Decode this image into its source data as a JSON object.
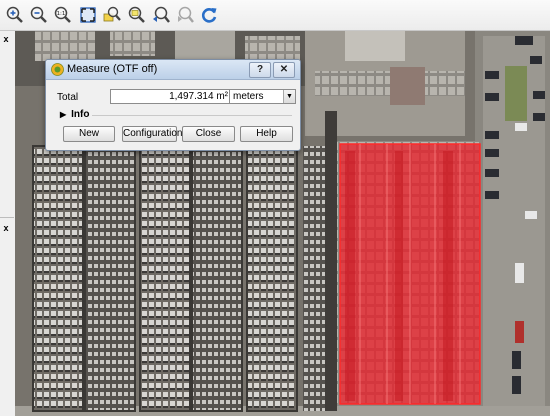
{
  "toolbar": {
    "tools": [
      {
        "icon": "zoom-in-icon"
      },
      {
        "icon": "zoom-out-icon"
      },
      {
        "icon": "zoom-native-icon",
        "text": "1:1"
      },
      {
        "icon": "zoom-full-icon"
      },
      {
        "icon": "zoom-to-layer-icon"
      },
      {
        "icon": "zoom-to-selection-icon"
      },
      {
        "icon": "zoom-last-icon"
      },
      {
        "icon": "zoom-next-icon"
      },
      {
        "icon": "refresh-icon"
      }
    ]
  },
  "dialog": {
    "title": "Measure (OTF off)",
    "help_glyph": "?",
    "close_glyph": "✕",
    "total_label": "Total",
    "total_value": "1,497.314 m²",
    "units": "meters",
    "info_label": "Info",
    "buttons": {
      "new": "New",
      "configuration": "Configuration",
      "close": "Close",
      "help": "Help"
    }
  },
  "left_panel": {
    "close_glyph": "x"
  },
  "colors": {
    "measure_fill": "#e8202a",
    "measure_stroke": "#ff2a2a",
    "titlebar": "#bcd0e8"
  }
}
